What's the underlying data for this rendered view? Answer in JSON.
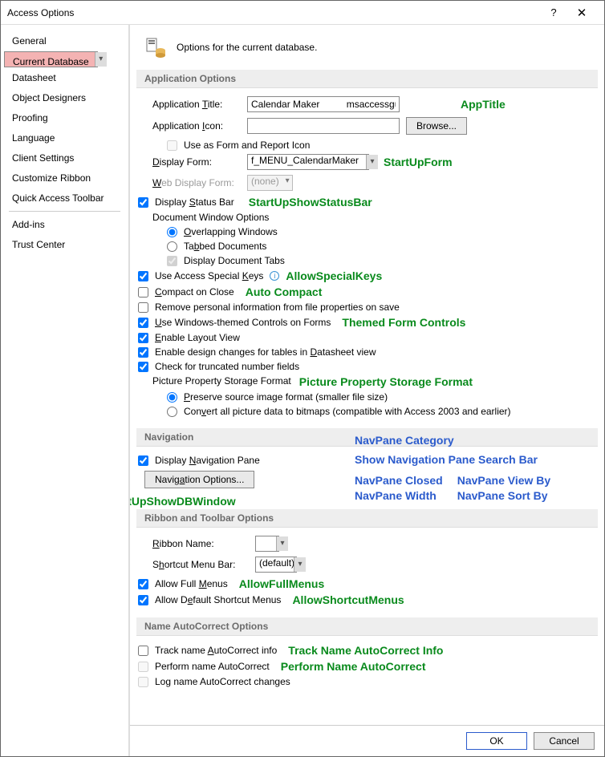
{
  "title": "Access Options",
  "page_desc": "Options for the current database.",
  "sidebar": {
    "items": [
      "General",
      "Current Database",
      "Datasheet",
      "Object Designers",
      "Proofing",
      "Language",
      "Client Settings",
      "Customize Ribbon",
      "Quick Access Toolbar"
    ],
    "items2": [
      "Add-ins",
      "Trust Center"
    ],
    "selected": 1
  },
  "s1": {
    "hdr": "Application Options",
    "app_title_lbl": "Application Title:",
    "app_title_val": "Calendar Maker          msaccessgurus.com",
    "app_icon_lbl": "Application Icon:",
    "browse": "Browse...",
    "use_icon": "Use as Form and Report Icon",
    "disp_form_lbl": "Display Form:",
    "disp_form_val": "f_MENU_CalendarMaker",
    "web_form_lbl": "Web Display Form:",
    "web_form_val": "(none)",
    "status_bar": "Display Status Bar",
    "doc_opts": "Document Window Options",
    "overlap": "Overlapping Windows",
    "tabbed": "Tabbed Documents",
    "disp_tabs": "Display Document Tabs",
    "special_keys": "Use Access Special Keys",
    "compact": "Compact on Close",
    "remove_pi": "Remove personal information from file properties on save",
    "themed": "Use Windows-themed Controls on Forms",
    "layout": "Enable Layout View",
    "design_chg": "Enable design changes for tables in Datasheet view",
    "trunc": "Check for truncated number fields",
    "pic_hdr": "Picture Property Storage Format",
    "preserve": "Preserve source image format (smaller file size)",
    "convert": "Convert all picture data to bitmaps (compatible with Access 2003 and earlier)"
  },
  "s2": {
    "hdr": "Navigation",
    "disp_nav": "Display Navigation Pane",
    "nav_opts": "Navigation Options..."
  },
  "s3": {
    "hdr": "Ribbon and Toolbar Options",
    "ribbon_lbl": "Ribbon Name:",
    "shortcut_lbl": "Shortcut Menu Bar:",
    "shortcut_val": "(default)",
    "full_menus": "Allow Full Menus",
    "def_short": "Allow Default Shortcut Menus"
  },
  "s4": {
    "hdr": "Name AutoCorrect Options",
    "track": "Track name AutoCorrect info",
    "perform": "Perform name AutoCorrect",
    "log": "Log name AutoCorrect changes"
  },
  "ann": {
    "app_title": "AppTitle",
    "startup_form": "StartUpForm",
    "status_bar": "StartUpShowStatusBar",
    "special": "AllowSpecialKeys",
    "compact": "Auto Compact",
    "themed": "Themed Form Controls",
    "pic": "Picture Property Storage Format",
    "nav_cat": "NavPane Category",
    "nav_search": "Show Navigation Pane Search Bar",
    "nav_closed": "NavPane Closed",
    "nav_view": "NavPane View By",
    "nav_width": "NavPane Width",
    "nav_sort": "NavPane Sort By",
    "dbwin": "StartUpShowDBWindow",
    "full": "AllowFullMenus",
    "short": "AllowShortcutMenus",
    "track": "Track Name AutoCorrect Info",
    "perform": "Perform Name AutoCorrect"
  },
  "footer": {
    "ok": "OK",
    "cancel": "Cancel"
  }
}
